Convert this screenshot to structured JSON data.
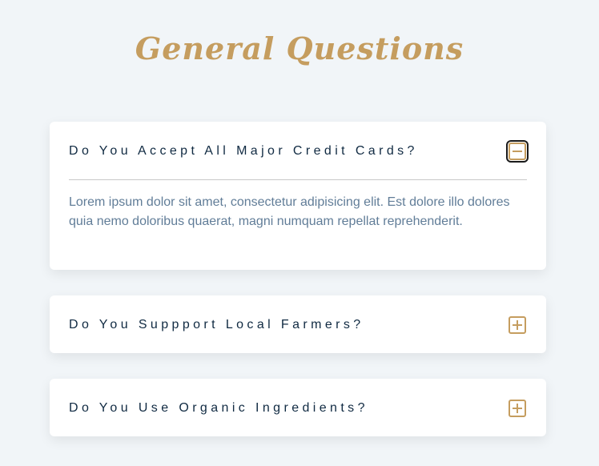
{
  "page": {
    "title": "General Questions"
  },
  "questions": [
    {
      "title": "Do You Accept All Major Credit Cards?",
      "expanded": true,
      "toggle_icon": "minus-icon",
      "answer": "Lorem ipsum dolor sit amet, consectetur adipisicing elit. Est dolore illo dolores quia nemo doloribus quaerat, magni numquam repellat reprehenderit."
    },
    {
      "title": "Do You Suppport Local Farmers?",
      "expanded": false,
      "toggle_icon": "plus-icon"
    },
    {
      "title": "Do You Use Organic Ingredients?",
      "expanded": false,
      "toggle_icon": "plus-icon"
    }
  ],
  "colors": {
    "background": "#f1f5f8",
    "accent": "#c59d5f",
    "heading": "#102a42",
    "body_text": "#617d98",
    "card": "#ffffff"
  }
}
